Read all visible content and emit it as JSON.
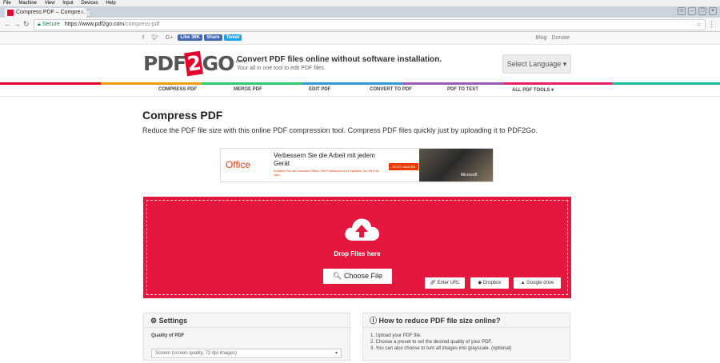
{
  "os_menu": [
    "File",
    "Machine",
    "View",
    "Input",
    "Devices",
    "Help"
  ],
  "browser": {
    "tab_title": "Compress PDF – Compre...",
    "secure_label": "Secure",
    "url_host": "https://www.pdf2go.com",
    "url_path": "/compress-pdf"
  },
  "topbar": {
    "fb_like": "Like 38K",
    "fb_share": "Share",
    "tweet": "Tweet",
    "links": [
      "Blog",
      "Donate"
    ]
  },
  "header": {
    "logo_left": "PDF",
    "logo_two": "2",
    "logo_right": "GO",
    "logo_com": ".com",
    "tagline": "Convert PDF files online without software installation.",
    "subtagline": "Your all in one tool to edit PDF files.",
    "language_button": "Select Language ▾"
  },
  "toolnav": [
    "COMPRESS PDF",
    "MERGE PDF",
    "EDIT PDF",
    "CONVERT TO PDF",
    "PDF TO TEXT",
    "ALL PDF TOOLS ▾"
  ],
  "page": {
    "title": "Compress PDF",
    "description": "Reduce the PDF file size with this online PDF compression tool. Compress PDF files quickly just by uploading it to PDF2Go."
  },
  "ad": {
    "brand": "Office",
    "headline": "Verbessern Sie die Arbeit mit jedem Gerät",
    "small": "Erhalten Sie die neuesten Office 365 Funktionen und Updates, nur 99 € im Jahr",
    "cta": "JETZT KAUFEN",
    "sponsor": "Microsoft"
  },
  "upload": {
    "drop_label": "Drop Files here",
    "choose_file": "Choose File",
    "enter_url": "Enter URL",
    "dropbox": "Dropbox",
    "google_drive": "Google drive",
    "bg_color": "#e4183f"
  },
  "settings": {
    "title": "Settings",
    "quality_label": "Quality of PDF",
    "quality_value": "Screen (screen quality, 72 dpi images)"
  },
  "howto": {
    "title": "How to reduce PDF file size online?",
    "steps": [
      "1. Upload your PDF file.",
      "2. Choose a preset to set the desired quality of your PDF.",
      "3. You can also choose to turn all images into grayscale. (optional)"
    ]
  }
}
